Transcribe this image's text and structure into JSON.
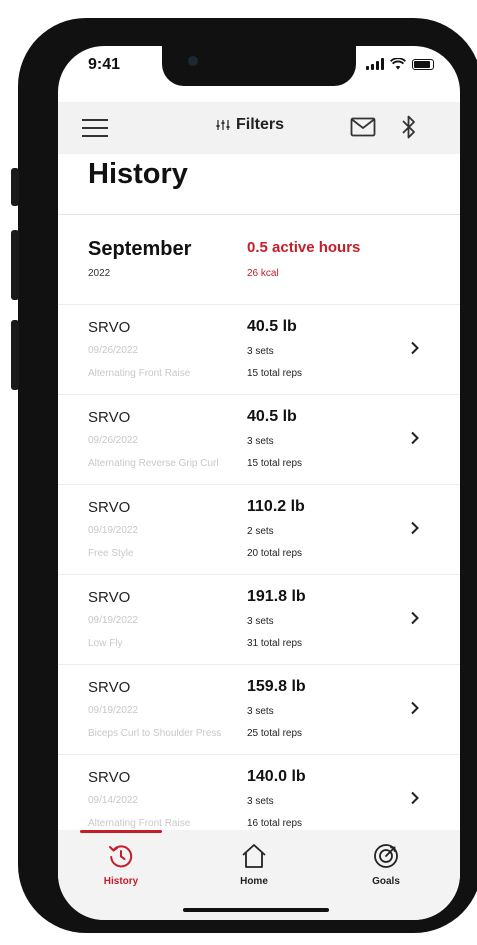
{
  "status": {
    "time": "9:41"
  },
  "appbar": {
    "filters_label": "Filters"
  },
  "page": {
    "title": "History"
  },
  "summary": {
    "month": "September",
    "year": "2022",
    "active_hours": "0.5 active hours",
    "kcal": "26 kcal"
  },
  "workouts": [
    {
      "brand": "SRVO",
      "date": "09/26/2022",
      "exercise": "Alternating Front Raise",
      "weight": "40.5 lb",
      "sets": "3 sets",
      "reps": "15 total reps"
    },
    {
      "brand": "SRVO",
      "date": "09/26/2022",
      "exercise": "Alternating Reverse Grip Curl",
      "weight": "40.5 lb",
      "sets": "3 sets",
      "reps": "15 total reps"
    },
    {
      "brand": "SRVO",
      "date": "09/19/2022",
      "exercise": "Free Style",
      "weight": "110.2 lb",
      "sets": "2 sets",
      "reps": "20 total reps"
    },
    {
      "brand": "SRVO",
      "date": "09/19/2022",
      "exercise": "Low Fly",
      "weight": "191.8 lb",
      "sets": "3 sets",
      "reps": "31 total reps"
    },
    {
      "brand": "SRVO",
      "date": "09/19/2022",
      "exercise": "Biceps Curl to Shoulder Press",
      "weight": "159.8 lb",
      "sets": "3 sets",
      "reps": "25 total reps"
    },
    {
      "brand": "SRVO",
      "date": "09/14/2022",
      "exercise": "Alternating Front Raise",
      "weight": "140.0 lb",
      "sets": "3 sets",
      "reps": "16 total reps"
    }
  ],
  "tabs": [
    {
      "label": "History",
      "icon": "history-icon",
      "active": true
    },
    {
      "label": "Home",
      "icon": "home-icon",
      "active": false
    },
    {
      "label": "Goals",
      "icon": "target-icon",
      "active": false
    }
  ],
  "colors": {
    "accent": "#c41e2a",
    "appbar_bg": "#f2f2f2",
    "muted_text": "#c8c8c8"
  }
}
